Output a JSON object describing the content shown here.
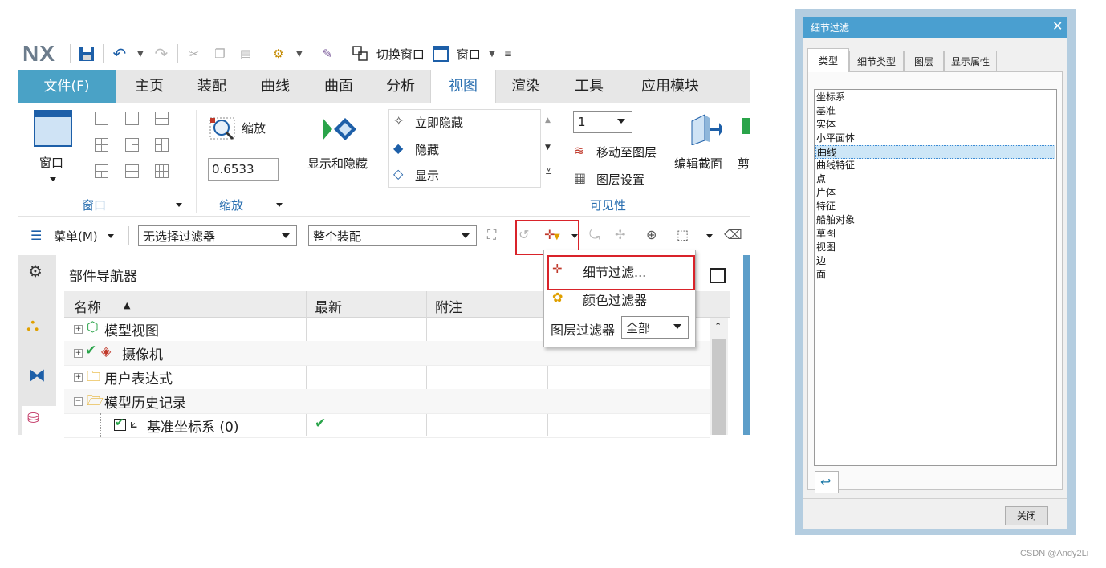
{
  "quick_access": {
    "logo": "NX",
    "switch_window": "切换窗口",
    "window": "窗口"
  },
  "menu_tabs": [
    "文件(F)",
    "主页",
    "装配",
    "曲线",
    "曲面",
    "分析",
    "视图",
    "渲染",
    "工具",
    "应用模块"
  ],
  "active_tab": "视图",
  "ribbon": {
    "window_btn": "窗口",
    "window_group": "窗口",
    "zoom_btn": "缩放",
    "zoom_value": "0.6533",
    "zoom_group": "缩放",
    "show_hide": "显示和隐藏",
    "hide_now": "立即隐藏",
    "hide": "隐藏",
    "show": "显示",
    "layer_value": "1",
    "move_to_layer": "移动至图层",
    "layer_settings": "图层设置",
    "edit_section": "编辑截面",
    "clip": "剪",
    "visibility_group": "可见性"
  },
  "filter_bar": {
    "menu": "菜单(M)",
    "type_filter": "无选择过滤器",
    "scope": "整个装配"
  },
  "dropdown_menu": {
    "detail_filter": "细节过滤...",
    "color_filter": "颜色过滤器",
    "layer_filter_label": "图层过滤器",
    "layer_filter_value": "全部"
  },
  "navigator": {
    "title": "部件导航器",
    "columns": [
      "名称",
      "最新",
      "附注"
    ],
    "rows": [
      {
        "label": "模型视图",
        "latest": ""
      },
      {
        "label": "摄像机",
        "latest": ""
      },
      {
        "label": "用户表达式",
        "latest": ""
      },
      {
        "label": "模型历史记录",
        "latest": ""
      },
      {
        "label": "基准坐标系 (0)",
        "latest": "✔"
      }
    ]
  },
  "dialog": {
    "title": "细节过滤",
    "close_x": "✕",
    "tabs": [
      "类型",
      "细节类型",
      "图层",
      "显示属性"
    ],
    "items": [
      "坐标系",
      "基准",
      "实体",
      "小平面体",
      "曲线",
      "曲线特征",
      "点",
      "片体",
      "特征",
      "船舶对象",
      "草图",
      "视图",
      "边",
      "面"
    ],
    "selected_item": "曲线",
    "close_button": "关闭"
  },
  "credit": "CSDN @Andy2Li",
  "colors": {
    "accent": "#4aa2c6",
    "highlight_red": "#d9232a",
    "label_blue": "#2a6fb0"
  }
}
